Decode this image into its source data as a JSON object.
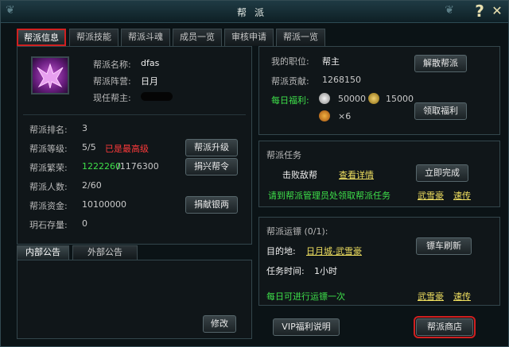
{
  "window": {
    "title": "帮派"
  },
  "tabs": [
    "帮派信息",
    "帮派技能",
    "帮派斗魂",
    "成员一览",
    "审核申请",
    "帮派一览"
  ],
  "guild": {
    "name_label": "帮派名称:",
    "name": "dfas",
    "camp_label": "帮派阵营:",
    "camp": "日月",
    "leader_label": "现任帮主:"
  },
  "stats": {
    "rank_label": "帮派排名:",
    "rank": "3",
    "level_label": "帮派等级:",
    "level": "5/5",
    "level_note": "已是最高级",
    "prosperity_label": "帮派繁荣:",
    "prosperity_cur": "1222260",
    "prosperity_max": "/1176300",
    "members_label": "帮派人数:",
    "members": "2/60",
    "funds_label": "帮派资金:",
    "funds": "10100000",
    "stone_label": "玥石存量:",
    "stone": "0"
  },
  "buttons": {
    "upgrade": "帮派升级",
    "donate_order": "捐兴帮令",
    "donate_silver": "捐献银两",
    "disband": "解散帮派",
    "claim": "领取福利",
    "complete": "立即完成",
    "refresh": "镖车刷新",
    "modify": "修改",
    "vip": "VIP福利说明",
    "shop": "帮派商店"
  },
  "notice_tabs": [
    "内部公告",
    "外部公告"
  ],
  "my": {
    "position_label": "我的职位:",
    "position": "帮主",
    "contrib_label": "帮派贡献:",
    "contrib": "1268150",
    "welfare_label": "每日福利:",
    "coin1": "50000",
    "coin2": "15000",
    "count": "×6"
  },
  "task": {
    "header": "帮派任务",
    "name": "击败敌帮",
    "detail": "查看详情",
    "hint": "请到帮派管理员处领取帮派任务",
    "npc": "武雪豪",
    "transfer": "速传"
  },
  "escort": {
    "header": "帮派运镖 (0/1):",
    "dest_label": "目的地:",
    "dest": "日月城-武雪豪",
    "time_label": "任务时间:",
    "time": "1小时",
    "daily": "每日可进行运镖一次",
    "npc": "武雪豪",
    "transfer": "速传"
  }
}
